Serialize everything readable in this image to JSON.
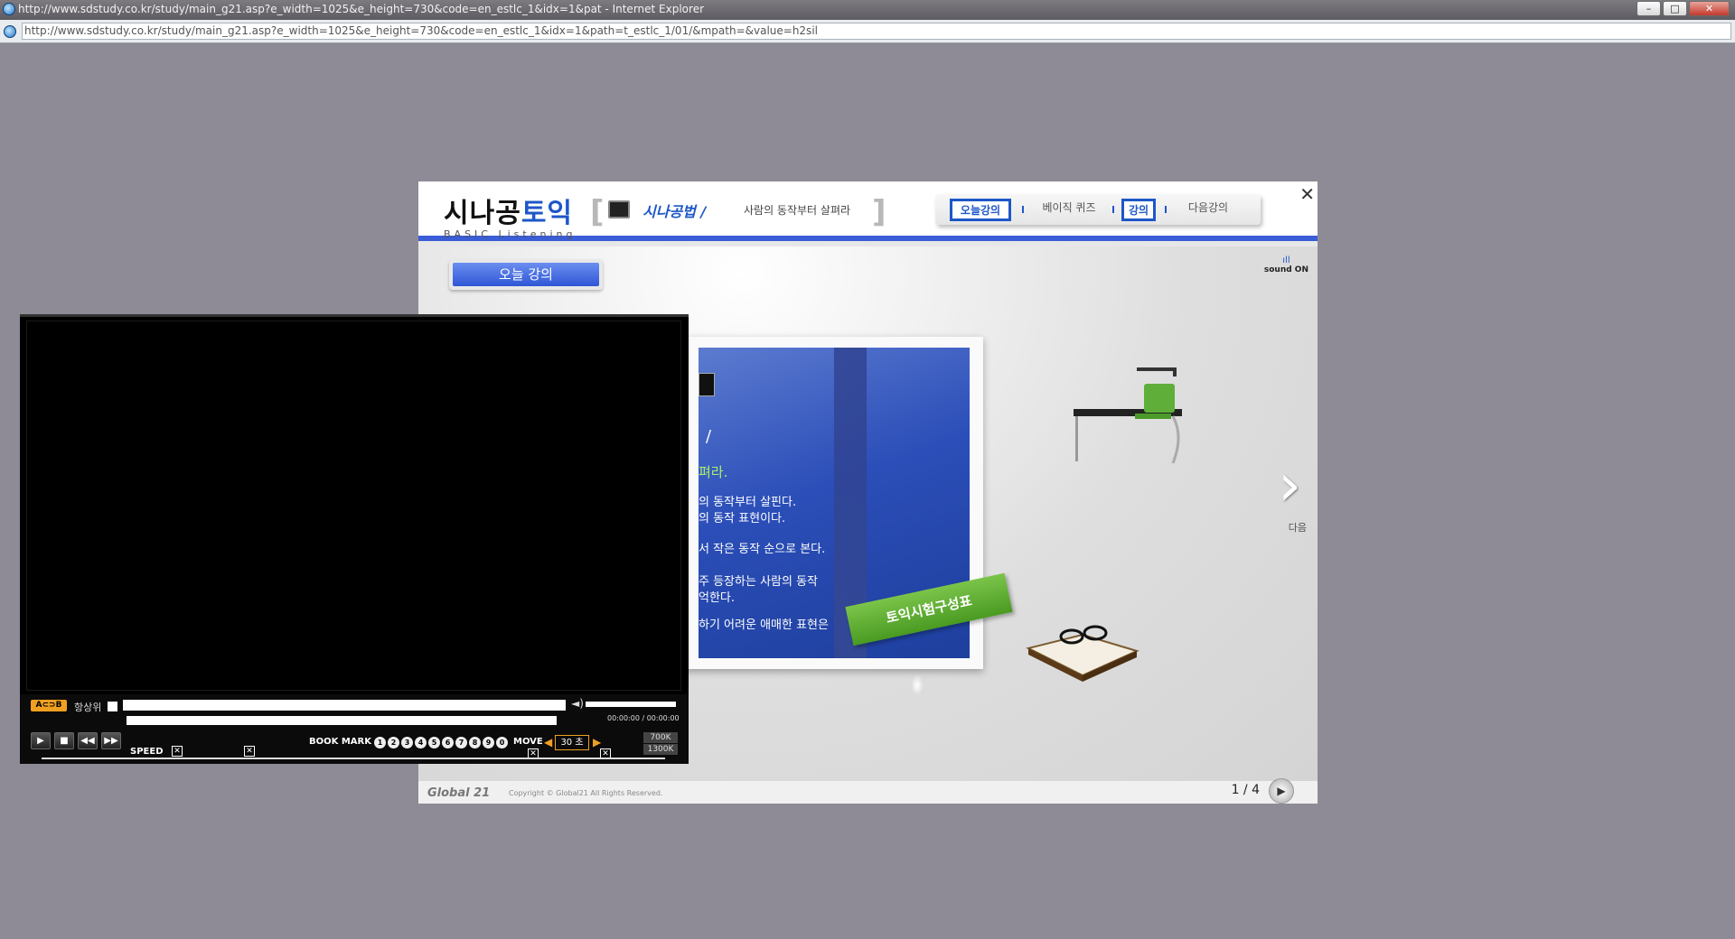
{
  "window": {
    "title": "http://www.sdstudy.co.kr/study/main_g21.asp?e_width=1025&e_height=730&code=en_estlc_1&idx=1&pat - Internet Explorer",
    "minimize": "–",
    "maximize": "□",
    "close": "✕"
  },
  "address": {
    "url": "http://www.sdstudy.co.kr/study/main_g21.asp?e_width=1025&e_height=730&code=en_estlc_1&idx=1&path=t_estlc_1/01/&mpath=&value=h2sil"
  },
  "lecture": {
    "logo_main_a": "시나공",
    "logo_main_b": "토익",
    "logo_sub": "BASIC Listening",
    "course_brand": "시나공법 /",
    "course_title": "사람의 동작부터 살펴라",
    "bracket_open": "[",
    "bracket_close": "]",
    "nav": {
      "today": "오늘강의",
      "quiz": "베이직 퀴즈",
      "lecture": "강의",
      "next": "다음강의"
    },
    "close": "✕",
    "today_tab": "오늘 강의",
    "sound_bars": "ıll",
    "sound": "sound ON",
    "board_lines": [
      "/",
      "펴라.",
      "의 동작부터 살핀다.",
      "의 동작 표현이다.",
      "서 작은 동작 순으로 본다.",
      "주 등장하는 사람의 동작",
      "억한다.",
      "하기 어려운 애매한 표현은"
    ],
    "ribbon": "토익시험구성표",
    "next_arrow": "›",
    "next_label": "다음",
    "footer_logo": "Global 21",
    "copyright": "Copyright © Global21 All Rights Reserved.",
    "page_counter": "1 / 4",
    "page_next": "▶"
  },
  "player": {
    "badge": "A⊂⊃B",
    "always_on_top": "항상위",
    "volume_icon": "◄)",
    "time": "00:00:00  /  00:00:00",
    "play": "▶",
    "stop": "■",
    "rewind": "◀◀",
    "forward": "▶▶",
    "speed_label": "SPEED",
    "bookmark_label": "BOOK MARK",
    "bookmarks": [
      "1",
      "2",
      "3",
      "4",
      "5",
      "6",
      "7",
      "8",
      "9",
      "0"
    ],
    "move_label": "MOVE",
    "move_value": "30 초",
    "bitrate_low": "700K",
    "bitrate_high": "1300K"
  }
}
